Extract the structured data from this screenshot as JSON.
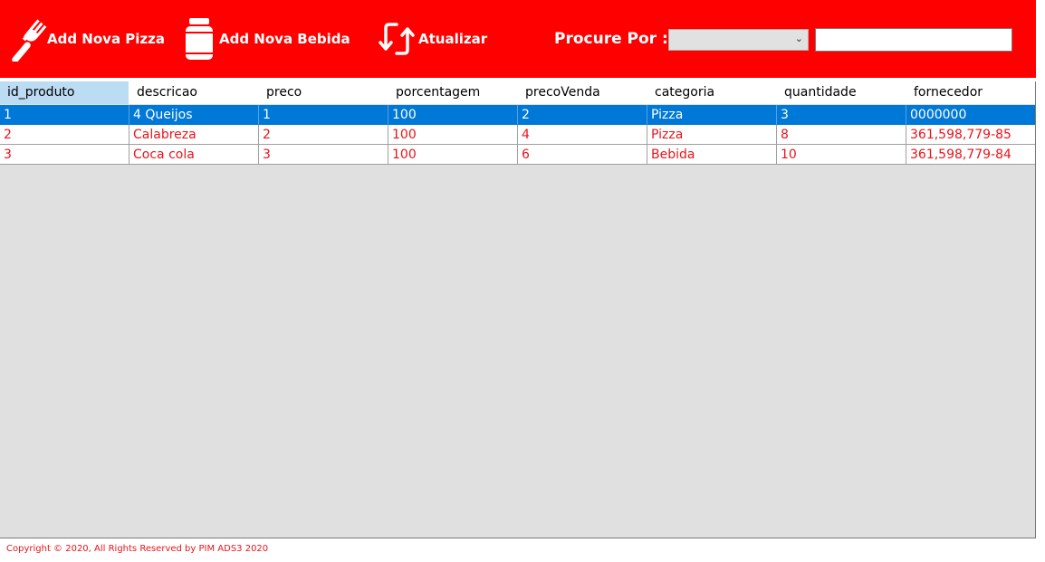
{
  "toolbar": {
    "buttons": [
      {
        "label": "Add Nova Pizza",
        "icon": "fork-icon"
      },
      {
        "label": "Add Nova Bebida",
        "icon": "jar-icon"
      },
      {
        "label": "Atualizar",
        "icon": "refresh-icon"
      }
    ],
    "search_label": "Procure Por :",
    "search_select_value": "",
    "search_input_value": ""
  },
  "grid": {
    "columns": [
      "id_produto",
      "descricao",
      "preco",
      "porcentagem",
      "precoVenda",
      "categoria",
      "quantidade",
      "fornecedor"
    ],
    "rows": [
      [
        "1",
        "4 Queijos",
        "1",
        "100",
        "2",
        "Pizza",
        "3",
        "0000000"
      ],
      [
        "2",
        "Calabreza",
        "2",
        "100",
        "4",
        "Pizza",
        "8",
        "361,598,779-85"
      ],
      [
        "3",
        "Coca cola",
        "3",
        "100",
        "6",
        "Bebida",
        "10",
        "361,598,779-84"
      ]
    ],
    "selected_row": 0
  },
  "footer": {
    "copyright": "Copyright © 2020, All Rights Reserved by PIM ADS3 2020"
  },
  "colors": {
    "toolbar_bg": "#ff0000",
    "selection": "#0078d7",
    "row_text": "#e8141c",
    "grid_bg": "#e0e0e0"
  }
}
